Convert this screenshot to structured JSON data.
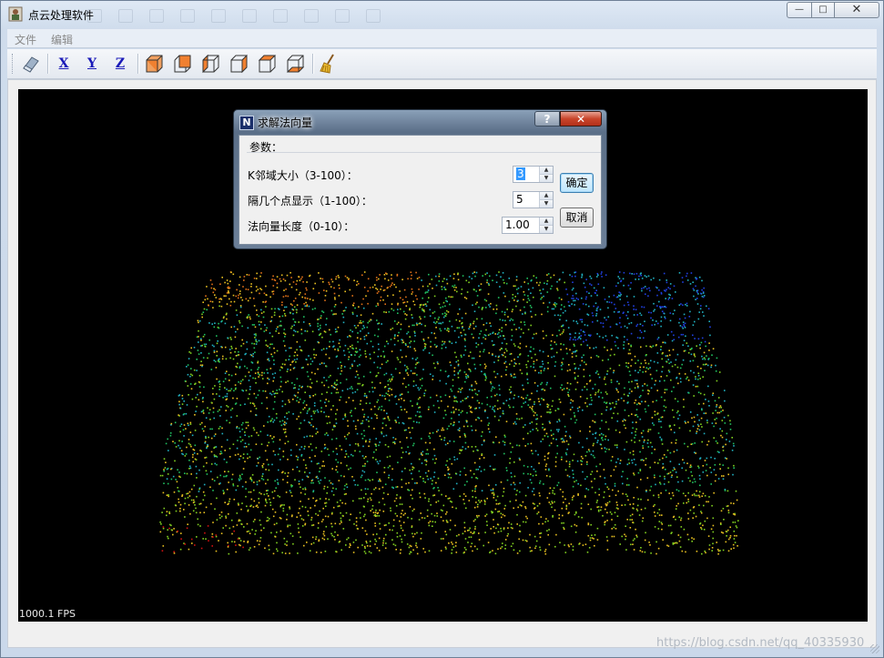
{
  "window": {
    "title": "点云处理软件",
    "controls": {
      "minimize": "—",
      "maximize": "□",
      "close": "✕"
    }
  },
  "menu": [
    {
      "label": "文件"
    },
    {
      "label": "编辑"
    }
  ],
  "toolbar": {
    "buttons": [
      {
        "name": "eraser-icon"
      },
      {
        "name": "axis-x-button",
        "label": "X"
      },
      {
        "name": "axis-y-button",
        "label": "Y"
      },
      {
        "name": "axis-z-button",
        "label": "Z"
      },
      {
        "name": "front-view-icon"
      },
      {
        "name": "back-view-icon"
      },
      {
        "name": "left-view-icon"
      },
      {
        "name": "right-view-icon"
      },
      {
        "name": "top-view-icon"
      },
      {
        "name": "bottom-view-icon"
      },
      {
        "name": "broom-icon"
      }
    ]
  },
  "viewer": {
    "fps": "1000.1 FPS",
    "background": "#000000",
    "colormap": [
      "#d01010",
      "#e07018",
      "#e8c020",
      "#80d020",
      "#20c060",
      "#20b0c0",
      "#2040e0"
    ]
  },
  "dialog": {
    "title": "求解法向量",
    "help": "?",
    "close": "✕",
    "group_title": "参数：",
    "params": [
      {
        "label": "K邻域大小（3-100）：",
        "value": "3"
      },
      {
        "label": "隔几个点显示（1-100）：",
        "value": "5"
      },
      {
        "label": "法向量长度（0-10）：",
        "value": "1.00"
      }
    ],
    "ok_label": "确定",
    "cancel_label": "取消"
  },
  "watermark": "https://blog.csdn.net/qq_40335930"
}
